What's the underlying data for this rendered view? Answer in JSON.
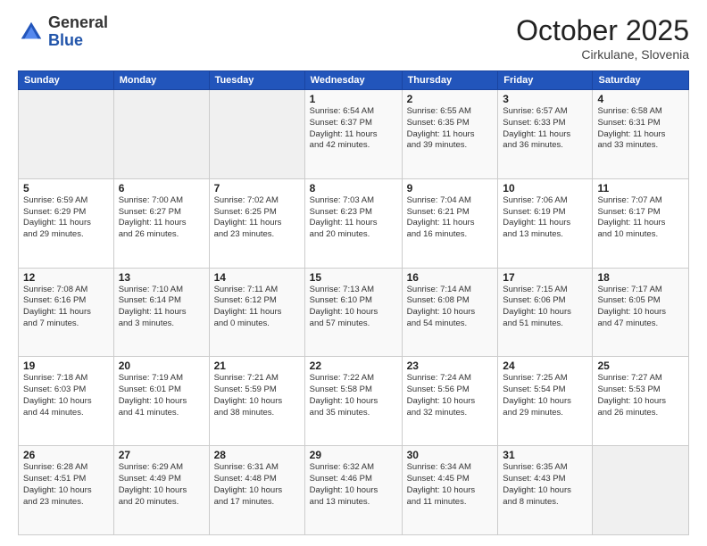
{
  "logo": {
    "general": "General",
    "blue": "Blue"
  },
  "header": {
    "title": "October 2025",
    "subtitle": "Cirkulane, Slovenia"
  },
  "weekdays": [
    "Sunday",
    "Monday",
    "Tuesday",
    "Wednesday",
    "Thursday",
    "Friday",
    "Saturday"
  ],
  "weeks": [
    [
      {
        "day": "",
        "info": ""
      },
      {
        "day": "",
        "info": ""
      },
      {
        "day": "",
        "info": ""
      },
      {
        "day": "1",
        "info": "Sunrise: 6:54 AM\nSunset: 6:37 PM\nDaylight: 11 hours\nand 42 minutes."
      },
      {
        "day": "2",
        "info": "Sunrise: 6:55 AM\nSunset: 6:35 PM\nDaylight: 11 hours\nand 39 minutes."
      },
      {
        "day": "3",
        "info": "Sunrise: 6:57 AM\nSunset: 6:33 PM\nDaylight: 11 hours\nand 36 minutes."
      },
      {
        "day": "4",
        "info": "Sunrise: 6:58 AM\nSunset: 6:31 PM\nDaylight: 11 hours\nand 33 minutes."
      }
    ],
    [
      {
        "day": "5",
        "info": "Sunrise: 6:59 AM\nSunset: 6:29 PM\nDaylight: 11 hours\nand 29 minutes."
      },
      {
        "day": "6",
        "info": "Sunrise: 7:00 AM\nSunset: 6:27 PM\nDaylight: 11 hours\nand 26 minutes."
      },
      {
        "day": "7",
        "info": "Sunrise: 7:02 AM\nSunset: 6:25 PM\nDaylight: 11 hours\nand 23 minutes."
      },
      {
        "day": "8",
        "info": "Sunrise: 7:03 AM\nSunset: 6:23 PM\nDaylight: 11 hours\nand 20 minutes."
      },
      {
        "day": "9",
        "info": "Sunrise: 7:04 AM\nSunset: 6:21 PM\nDaylight: 11 hours\nand 16 minutes."
      },
      {
        "day": "10",
        "info": "Sunrise: 7:06 AM\nSunset: 6:19 PM\nDaylight: 11 hours\nand 13 minutes."
      },
      {
        "day": "11",
        "info": "Sunrise: 7:07 AM\nSunset: 6:17 PM\nDaylight: 11 hours\nand 10 minutes."
      }
    ],
    [
      {
        "day": "12",
        "info": "Sunrise: 7:08 AM\nSunset: 6:16 PM\nDaylight: 11 hours\nand 7 minutes."
      },
      {
        "day": "13",
        "info": "Sunrise: 7:10 AM\nSunset: 6:14 PM\nDaylight: 11 hours\nand 3 minutes."
      },
      {
        "day": "14",
        "info": "Sunrise: 7:11 AM\nSunset: 6:12 PM\nDaylight: 11 hours\nand 0 minutes."
      },
      {
        "day": "15",
        "info": "Sunrise: 7:13 AM\nSunset: 6:10 PM\nDaylight: 10 hours\nand 57 minutes."
      },
      {
        "day": "16",
        "info": "Sunrise: 7:14 AM\nSunset: 6:08 PM\nDaylight: 10 hours\nand 54 minutes."
      },
      {
        "day": "17",
        "info": "Sunrise: 7:15 AM\nSunset: 6:06 PM\nDaylight: 10 hours\nand 51 minutes."
      },
      {
        "day": "18",
        "info": "Sunrise: 7:17 AM\nSunset: 6:05 PM\nDaylight: 10 hours\nand 47 minutes."
      }
    ],
    [
      {
        "day": "19",
        "info": "Sunrise: 7:18 AM\nSunset: 6:03 PM\nDaylight: 10 hours\nand 44 minutes."
      },
      {
        "day": "20",
        "info": "Sunrise: 7:19 AM\nSunset: 6:01 PM\nDaylight: 10 hours\nand 41 minutes."
      },
      {
        "day": "21",
        "info": "Sunrise: 7:21 AM\nSunset: 5:59 PM\nDaylight: 10 hours\nand 38 minutes."
      },
      {
        "day": "22",
        "info": "Sunrise: 7:22 AM\nSunset: 5:58 PM\nDaylight: 10 hours\nand 35 minutes."
      },
      {
        "day": "23",
        "info": "Sunrise: 7:24 AM\nSunset: 5:56 PM\nDaylight: 10 hours\nand 32 minutes."
      },
      {
        "day": "24",
        "info": "Sunrise: 7:25 AM\nSunset: 5:54 PM\nDaylight: 10 hours\nand 29 minutes."
      },
      {
        "day": "25",
        "info": "Sunrise: 7:27 AM\nSunset: 5:53 PM\nDaylight: 10 hours\nand 26 minutes."
      }
    ],
    [
      {
        "day": "26",
        "info": "Sunrise: 6:28 AM\nSunset: 4:51 PM\nDaylight: 10 hours\nand 23 minutes."
      },
      {
        "day": "27",
        "info": "Sunrise: 6:29 AM\nSunset: 4:49 PM\nDaylight: 10 hours\nand 20 minutes."
      },
      {
        "day": "28",
        "info": "Sunrise: 6:31 AM\nSunset: 4:48 PM\nDaylight: 10 hours\nand 17 minutes."
      },
      {
        "day": "29",
        "info": "Sunrise: 6:32 AM\nSunset: 4:46 PM\nDaylight: 10 hours\nand 13 minutes."
      },
      {
        "day": "30",
        "info": "Sunrise: 6:34 AM\nSunset: 4:45 PM\nDaylight: 10 hours\nand 11 minutes."
      },
      {
        "day": "31",
        "info": "Sunrise: 6:35 AM\nSunset: 4:43 PM\nDaylight: 10 hours\nand 8 minutes."
      },
      {
        "day": "",
        "info": ""
      }
    ]
  ]
}
